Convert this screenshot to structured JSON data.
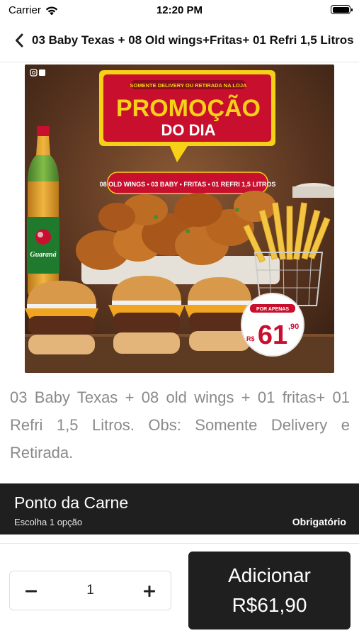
{
  "status_bar": {
    "carrier": "Carrier",
    "time": "12:20 PM"
  },
  "nav": {
    "title": "03 Baby Texas + 08 Old wings+Fritas+ 01 Refri 1,5 Litros"
  },
  "product_image": {
    "banner_top": "SOMENTE DELIVERY OU RETIRADA NA LOJA",
    "headline": "PROMOÇÃO",
    "subheadline": "DO DIA",
    "ribbon": "08 OLD WINGS • 03 BABY • FRITAS • 01 REFRI 1,5 LITROS",
    "price_prefix": "POR APENAS",
    "price_currency": "R$",
    "price_whole": "61",
    "price_cents": ",90",
    "bottle_brand": "Guaraná"
  },
  "description": "03 Baby Texas + 08 old wings + 01 fritas+ 01 Refri 1,5 Litros. Obs: Somente Delivery e Retirada.",
  "option_section": {
    "title": "Ponto da Carne",
    "subtitle": "Escolha 1 opção",
    "required_label": "Obrigatório"
  },
  "quantity": {
    "value": "1",
    "minus_symbol": "−",
    "plus_symbol": "+"
  },
  "add_button": {
    "label": "Adicionar",
    "price": "R$61,90"
  },
  "colors": {
    "dark": "#1f1f1f",
    "promo_red": "#c8102e",
    "promo_yellow": "#f7d117"
  }
}
